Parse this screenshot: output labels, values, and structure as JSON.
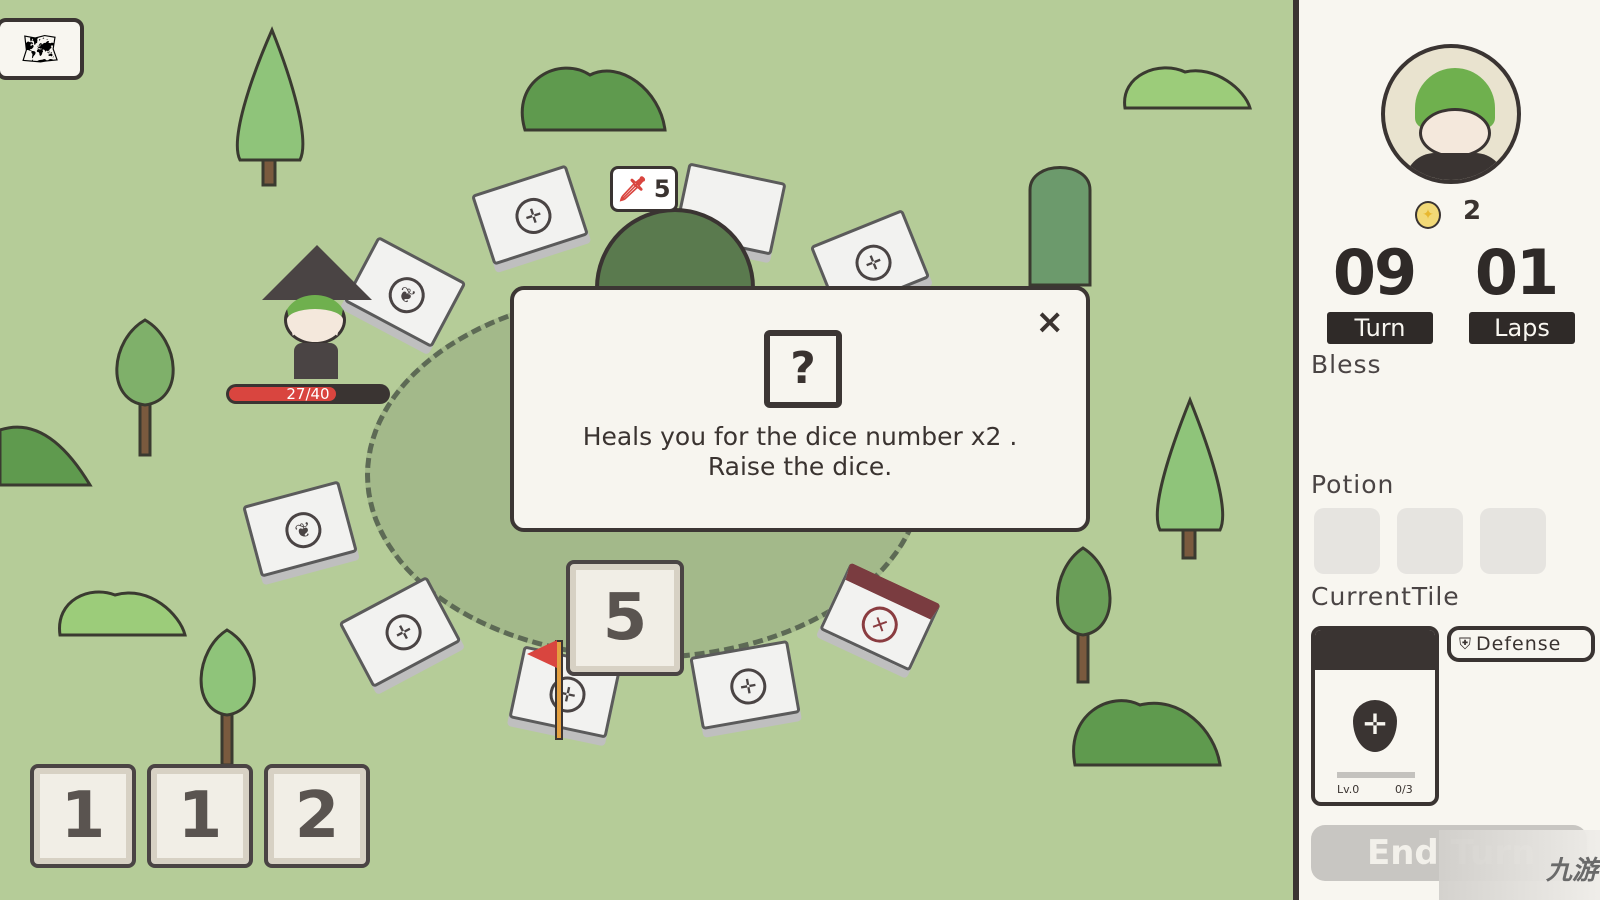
{
  "hud": {
    "map_button_icon": "map-icon"
  },
  "player": {
    "hp": "27/40",
    "hp_fraction": 0.675
  },
  "enemy_badge": {
    "value": "5",
    "icon": "sword-icon"
  },
  "dialog": {
    "icon": "question-block-icon",
    "line1": "Heals you for the dice number x2 .",
    "line2": "Raise the dice.",
    "close": "×"
  },
  "board_die": "5",
  "dice_pool": [
    "1",
    "1",
    "2"
  ],
  "panel": {
    "coins": "2",
    "turn_value": "09",
    "turn_label": "Turn",
    "laps_value": "01",
    "laps_label": "Laps",
    "bless_label": "Bless",
    "potion_label": "Potion",
    "current_tile_label": "CurrentTile",
    "tile_tag": "Defense",
    "tile_level": "Lv.0",
    "tile_progress": "0/3",
    "end_button": "End Turn"
  },
  "colors": {
    "grass": "#b5cc98",
    "panel": "#f8f6f0",
    "dark": "#3a3432",
    "hp": "#d9453f"
  }
}
